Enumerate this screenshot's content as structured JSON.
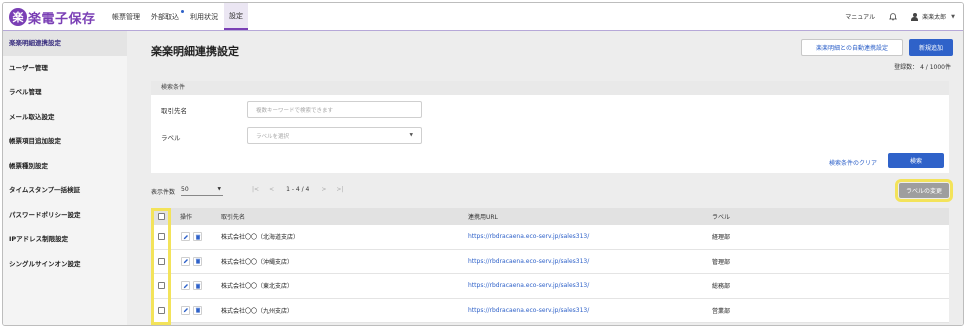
{
  "header": {
    "logo_mark": "楽",
    "logo_text": "楽電子保存",
    "nav": [
      {
        "label": "帳票管理"
      },
      {
        "label": "外部取込"
      },
      {
        "label": "利用状況"
      },
      {
        "label": "設定"
      }
    ],
    "manual": "マニュアル",
    "user_name": "楽楽太郎"
  },
  "sidebar": {
    "items": [
      {
        "label": "楽楽明細連携設定"
      },
      {
        "label": "ユーザー管理"
      },
      {
        "label": "ラベル管理"
      },
      {
        "label": "メール取込設定"
      },
      {
        "label": "帳票項目追加設定"
      },
      {
        "label": "帳票種別設定"
      },
      {
        "label": "タイムスタンプ一括検証"
      },
      {
        "label": "パスワードポリシー設定"
      },
      {
        "label": "IPアドレス制限設定"
      },
      {
        "label": "シングルサインオン設定"
      }
    ]
  },
  "main": {
    "title": "楽楽明細連携設定",
    "auto_settings_button": "楽楽明細との自動連携設定",
    "new_button": "新規追加",
    "registered_count": "登録数： 4 / 1000件",
    "search": {
      "header": "検索条件",
      "client_label": "取引先名",
      "client_placeholder": "複数キーワードで検索できます",
      "label_label": "ラベル",
      "label_placeholder": "ラベルを選択",
      "clear_link": "検索条件のクリア",
      "search_button": "検索"
    },
    "per_page_label": "表示件数",
    "per_page_value": "50",
    "pager": {
      "first": "|<",
      "prev": "<",
      "info": "1 - 4 / 4",
      "next": ">",
      "last": ">|"
    },
    "change_label_button": "ラベルの変更",
    "table": {
      "columns": [
        "操作",
        "取引先名",
        "連携用URL",
        "ラベル"
      ],
      "rows": [
        {
          "client": "株式会社〇〇（北海道支店）",
          "url": "https://rbdracaena.eco-serv.jp/sales313/",
          "label": "経理部"
        },
        {
          "client": "株式会社〇〇（沖縄支店）",
          "url": "https://rbdracaena.eco-serv.jp/sales313/",
          "label": "管理部"
        },
        {
          "client": "株式会社〇〇（東北支店）",
          "url": "https://rbdracaena.eco-serv.jp/sales313/",
          "label": "総務部"
        },
        {
          "client": "株式会社〇〇（九州支店）",
          "url": "https://rbdracaena.eco-serv.jp/sales313/",
          "label": "営業部"
        }
      ]
    }
  },
  "colors": {
    "brand_purple": "#7a3fb5",
    "primary_blue": "#2f62c9",
    "highlight_yellow": "#f3e35a"
  }
}
